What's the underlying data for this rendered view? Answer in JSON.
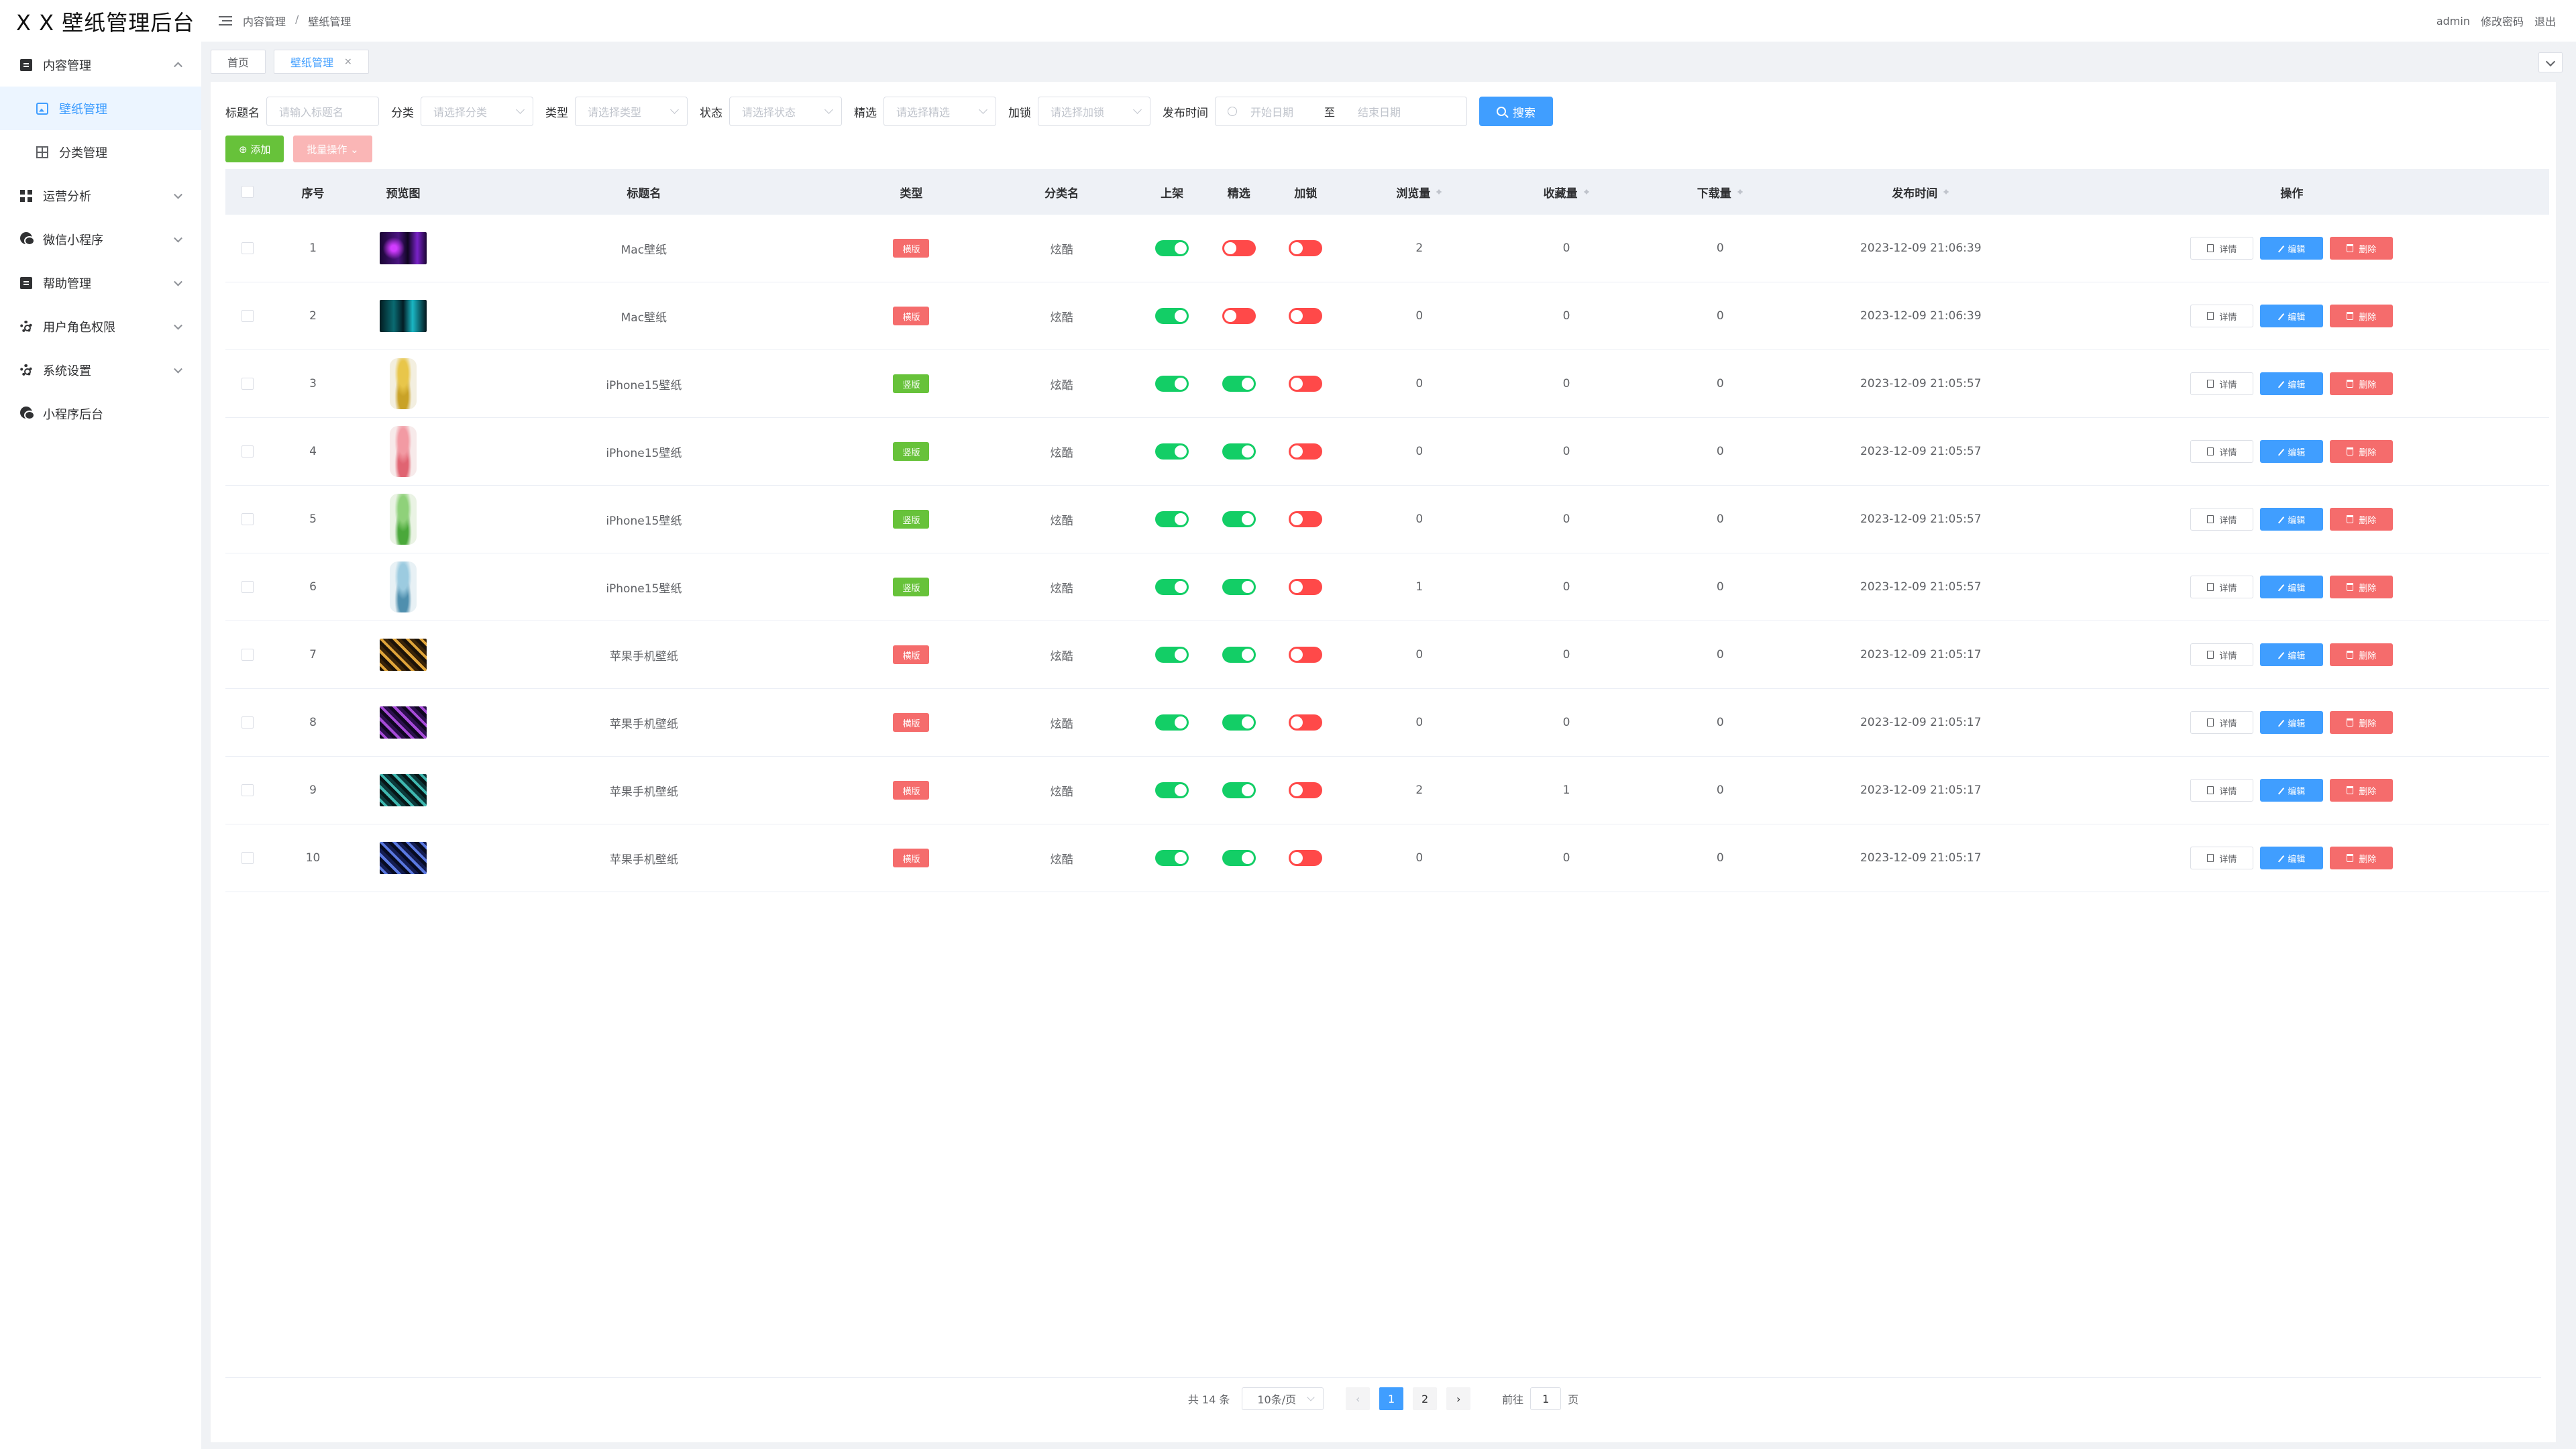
{
  "app": {
    "title": "X X 壁纸管理后台"
  },
  "sidebar": {
    "items": [
      {
        "label": "内容管理",
        "icon": "doc-icon",
        "expanded": true
      },
      {
        "label": "壁纸管理",
        "icon": "image-icon",
        "active": true,
        "sub": true
      },
      {
        "label": "分类管理",
        "icon": "grid-icon",
        "sub": true
      },
      {
        "label": "运营分析",
        "icon": "dashboard-icon"
      },
      {
        "label": "微信小程序",
        "icon": "wechat-icon"
      },
      {
        "label": "帮助管理",
        "icon": "doc-icon"
      },
      {
        "label": "用户角色权限",
        "icon": "gear-icon"
      },
      {
        "label": "系统设置",
        "icon": "gear-icon"
      },
      {
        "label": "小程序后台",
        "icon": "wechat-icon"
      }
    ]
  },
  "header": {
    "breadcrumb": [
      "内容管理",
      "壁纸管理"
    ],
    "separator": "/",
    "user": "admin",
    "change_password": "修改密码",
    "logout": "退出"
  },
  "tabs": [
    {
      "label": "首页"
    },
    {
      "label": "壁纸管理",
      "active": true,
      "close": "×"
    }
  ],
  "filters": {
    "title_label": "标题名",
    "title_placeholder": "请输入标题名",
    "category_label": "分类",
    "category_placeholder": "请选择分类",
    "type_label": "类型",
    "type_placeholder": "请选择类型",
    "status_label": "状态",
    "status_placeholder": "请选择状态",
    "featured_label": "精选",
    "featured_placeholder": "请选择精选",
    "locked_label": "加锁",
    "locked_placeholder": "请选择加锁",
    "date_label": "发布时间",
    "start_placeholder": "开始日期",
    "to": "至",
    "end_placeholder": "结束日期",
    "search_button": "搜索"
  },
  "actions": {
    "add": "⊕ 添加",
    "batch": "批量操作 ⌄"
  },
  "table": {
    "columns": {
      "index": "序号",
      "preview": "预览图",
      "title": "标题名",
      "type": "类型",
      "category": "分类名",
      "on_shelf": "上架",
      "featured": "精选",
      "locked": "加锁",
      "views": "浏览量",
      "favorites": "收藏量",
      "downloads": "下载量",
      "publish_time": "发布时间",
      "ops": "操作"
    },
    "ops": {
      "detail": "详情",
      "edit": "编辑",
      "delete": "删除"
    },
    "rows": [
      {
        "idx": "1",
        "thumb": "mac1",
        "title": "Mac壁纸",
        "type": "横版",
        "type_color": "red",
        "category": "炫酷",
        "on_shelf": true,
        "featured": false,
        "locked": false,
        "views": "2",
        "favorites": "0",
        "downloads": "0",
        "time": "2023-12-09 21:06:39"
      },
      {
        "idx": "2",
        "thumb": "mac2",
        "title": "Mac壁纸",
        "type": "横版",
        "type_color": "red",
        "category": "炫酷",
        "on_shelf": true,
        "featured": false,
        "locked": false,
        "views": "0",
        "favorites": "0",
        "downloads": "0",
        "time": "2023-12-09 21:06:39"
      },
      {
        "idx": "3",
        "thumb": "phone-yellow",
        "title": "iPhone15壁纸",
        "type": "竖版",
        "type_color": "green",
        "category": "炫酷",
        "on_shelf": true,
        "featured": true,
        "locked": false,
        "views": "0",
        "favorites": "0",
        "downloads": "0",
        "time": "2023-12-09 21:05:57"
      },
      {
        "idx": "4",
        "thumb": "phone-pink",
        "title": "iPhone15壁纸",
        "type": "竖版",
        "type_color": "green",
        "category": "炫酷",
        "on_shelf": true,
        "featured": true,
        "locked": false,
        "views": "0",
        "favorites": "0",
        "downloads": "0",
        "time": "2023-12-09 21:05:57"
      },
      {
        "idx": "5",
        "thumb": "phone-green",
        "title": "iPhone15壁纸",
        "type": "竖版",
        "type_color": "green",
        "category": "炫酷",
        "on_shelf": true,
        "featured": true,
        "locked": false,
        "views": "0",
        "favorites": "0",
        "downloads": "0",
        "time": "2023-12-09 21:05:57"
      },
      {
        "idx": "6",
        "thumb": "phone-blue",
        "title": "iPhone15壁纸",
        "type": "竖版",
        "type_color": "green",
        "category": "炫酷",
        "on_shelf": true,
        "featured": true,
        "locked": false,
        "views": "1",
        "favorites": "0",
        "downloads": "0",
        "time": "2023-12-09 21:05:57"
      },
      {
        "idx": "7",
        "thumb": "apple-gold",
        "title": "苹果手机壁纸",
        "type": "横版",
        "type_color": "red",
        "category": "炫酷",
        "on_shelf": true,
        "featured": true,
        "locked": false,
        "views": "0",
        "favorites": "0",
        "downloads": "0",
        "time": "2023-12-09 21:05:17"
      },
      {
        "idx": "8",
        "thumb": "apple-purple",
        "title": "苹果手机壁纸",
        "type": "横版",
        "type_color": "red",
        "category": "炫酷",
        "on_shelf": true,
        "featured": true,
        "locked": false,
        "views": "0",
        "favorites": "0",
        "downloads": "0",
        "time": "2023-12-09 21:05:17"
      },
      {
        "idx": "9",
        "thumb": "apple-teal",
        "title": "苹果手机壁纸",
        "type": "横版",
        "type_color": "red",
        "category": "炫酷",
        "on_shelf": true,
        "featured": true,
        "locked": false,
        "views": "2",
        "favorites": "1",
        "downloads": "0",
        "time": "2023-12-09 21:05:17"
      },
      {
        "idx": "10",
        "thumb": "apple-blue",
        "title": "苹果手机壁纸",
        "type": "横版",
        "type_color": "red",
        "category": "炫酷",
        "on_shelf": true,
        "featured": true,
        "locked": false,
        "views": "0",
        "favorites": "0",
        "downloads": "0",
        "time": "2023-12-09 21:05:17"
      }
    ]
  },
  "pagination": {
    "total": "共 14 条",
    "page_size": "10条/页",
    "prev": "‹",
    "next": "›",
    "pages": [
      "1",
      "2"
    ],
    "current": "1",
    "goto_label": "前往",
    "goto_value": "1",
    "goto_unit": "页"
  },
  "colors": {
    "primary": "#409eff",
    "success": "#67c23a",
    "danger": "#f56c6c",
    "switch_on": "#13ce66",
    "switch_off": "#ff4949"
  }
}
